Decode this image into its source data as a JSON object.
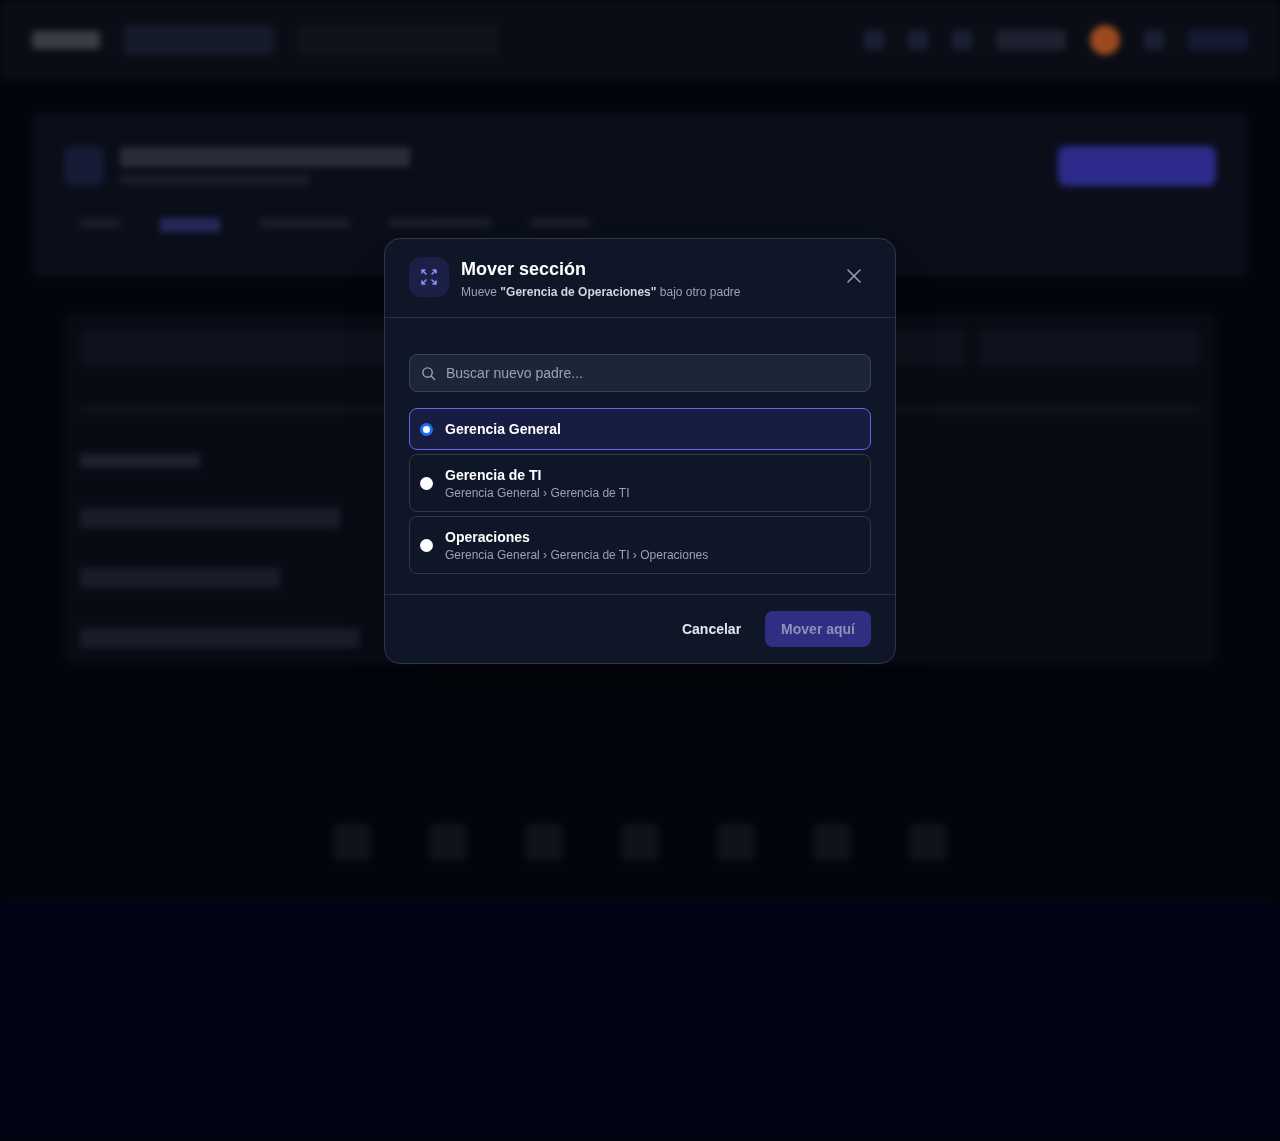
{
  "dialog": {
    "title": "Mover sección",
    "subtitle": "Mueve **\"Gerencia de Operaciones\"** bajo otro padre",
    "search": {
      "placeholder": "Buscar nuevo padre..."
    },
    "options": [
      {
        "label": "Gerencia General",
        "selected": true
      },
      {
        "label": "Gerencia de TI",
        "path": "Gerencia General › Gerencia de TI",
        "selected": false
      },
      {
        "label": "Operaciones",
        "path": "Gerencia General › Gerencia de TI › Operaciones",
        "selected": false
      }
    ],
    "buttons": {
      "cancel": "Cancelar",
      "confirm": "Mover aquí"
    }
  }
}
